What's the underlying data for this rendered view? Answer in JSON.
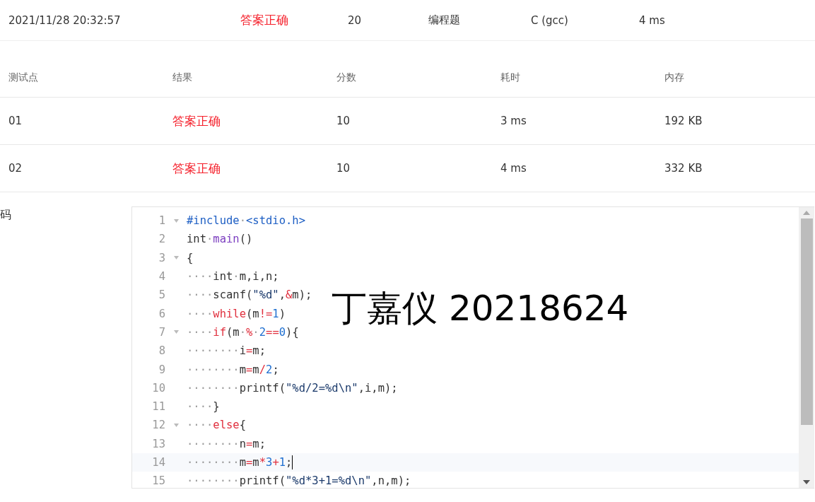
{
  "submission": {
    "time": "2021/11/28 20:32:57",
    "status": "答案正确",
    "score": "20",
    "problem_type": "编程题",
    "compiler": "C (gcc)",
    "duration": "4 ms"
  },
  "testcases": {
    "columns": [
      "测试点",
      "结果",
      "分数",
      "耗时",
      "内存"
    ],
    "rows": [
      {
        "id": "01",
        "result": "答案正确",
        "score": "10",
        "time": "3 ms",
        "memory": "192 KB"
      },
      {
        "id": "02",
        "result": "答案正确",
        "score": "10",
        "time": "4 ms",
        "memory": "332 KB"
      }
    ]
  },
  "code": {
    "label": "码",
    "overlay_text": "丁嘉仪 20218624",
    "lines": [
      {
        "number": "1",
        "foldable": true,
        "active": false,
        "tokens": [
          {
            "kind": "meta",
            "text": "#include"
          },
          {
            "kind": "ws",
            "text": "·"
          },
          {
            "kind": "meta",
            "text": "<stdio.h>"
          }
        ]
      },
      {
        "number": "2",
        "foldable": false,
        "active": false,
        "tokens": [
          {
            "kind": "plain",
            "text": "int"
          },
          {
            "kind": "ws",
            "text": "·"
          },
          {
            "kind": "def",
            "text": "main"
          },
          {
            "kind": "plain",
            "text": "()"
          }
        ]
      },
      {
        "number": "3",
        "foldable": true,
        "active": false,
        "tokens": [
          {
            "kind": "plain",
            "text": "{"
          }
        ]
      },
      {
        "number": "4",
        "foldable": false,
        "active": false,
        "tokens": [
          {
            "kind": "ws",
            "text": "····"
          },
          {
            "kind": "plain",
            "text": "int"
          },
          {
            "kind": "ws",
            "text": "·"
          },
          {
            "kind": "plain",
            "text": "m,i,n;"
          }
        ]
      },
      {
        "number": "5",
        "foldable": false,
        "active": false,
        "tokens": [
          {
            "kind": "ws",
            "text": "····"
          },
          {
            "kind": "plain",
            "text": "scanf("
          },
          {
            "kind": "str",
            "text": "\"%d\""
          },
          {
            "kind": "plain",
            "text": ","
          },
          {
            "kind": "op",
            "text": "&"
          },
          {
            "kind": "plain",
            "text": "m);"
          }
        ]
      },
      {
        "number": "6",
        "foldable": false,
        "active": false,
        "tokens": [
          {
            "kind": "ws",
            "text": "····"
          },
          {
            "kind": "ctrl",
            "text": "while"
          },
          {
            "kind": "plain",
            "text": "(m"
          },
          {
            "kind": "op",
            "text": "!="
          },
          {
            "kind": "num",
            "text": "1"
          },
          {
            "kind": "plain",
            "text": ")"
          }
        ]
      },
      {
        "number": "7",
        "foldable": true,
        "active": false,
        "tokens": [
          {
            "kind": "ws",
            "text": "····"
          },
          {
            "kind": "ctrl",
            "text": "if"
          },
          {
            "kind": "plain",
            "text": "(m"
          },
          {
            "kind": "ws",
            "text": "·"
          },
          {
            "kind": "op",
            "text": "%"
          },
          {
            "kind": "ws",
            "text": "·"
          },
          {
            "kind": "num",
            "text": "2"
          },
          {
            "kind": "op",
            "text": "=="
          },
          {
            "kind": "num",
            "text": "0"
          },
          {
            "kind": "plain",
            "text": "){"
          }
        ]
      },
      {
        "number": "8",
        "foldable": false,
        "active": false,
        "tokens": [
          {
            "kind": "ws",
            "text": "········"
          },
          {
            "kind": "plain",
            "text": "i"
          },
          {
            "kind": "op",
            "text": "="
          },
          {
            "kind": "plain",
            "text": "m;"
          }
        ]
      },
      {
        "number": "9",
        "foldable": false,
        "active": false,
        "tokens": [
          {
            "kind": "ws",
            "text": "········"
          },
          {
            "kind": "plain",
            "text": "m"
          },
          {
            "kind": "op",
            "text": "="
          },
          {
            "kind": "plain",
            "text": "m"
          },
          {
            "kind": "op",
            "text": "/"
          },
          {
            "kind": "num",
            "text": "2"
          },
          {
            "kind": "plain",
            "text": ";"
          }
        ]
      },
      {
        "number": "10",
        "foldable": false,
        "active": false,
        "tokens": [
          {
            "kind": "ws",
            "text": "········"
          },
          {
            "kind": "plain",
            "text": "printf("
          },
          {
            "kind": "str",
            "text": "\"%d/2=%d\\n\""
          },
          {
            "kind": "plain",
            "text": ",i,m);"
          }
        ]
      },
      {
        "number": "11",
        "foldable": false,
        "active": false,
        "tokens": [
          {
            "kind": "ws",
            "text": "····"
          },
          {
            "kind": "plain",
            "text": "}"
          }
        ]
      },
      {
        "number": "12",
        "foldable": true,
        "active": false,
        "tokens": [
          {
            "kind": "ws",
            "text": "····"
          },
          {
            "kind": "ctrl",
            "text": "else"
          },
          {
            "kind": "plain",
            "text": "{"
          }
        ]
      },
      {
        "number": "13",
        "foldable": false,
        "active": false,
        "tokens": [
          {
            "kind": "ws",
            "text": "········"
          },
          {
            "kind": "plain",
            "text": "n"
          },
          {
            "kind": "op",
            "text": "="
          },
          {
            "kind": "plain",
            "text": "m;"
          }
        ]
      },
      {
        "number": "14",
        "foldable": false,
        "active": true,
        "tokens": [
          {
            "kind": "ws",
            "text": "········"
          },
          {
            "kind": "plain",
            "text": "m"
          },
          {
            "kind": "op",
            "text": "="
          },
          {
            "kind": "plain",
            "text": "m"
          },
          {
            "kind": "op",
            "text": "*"
          },
          {
            "kind": "num",
            "text": "3"
          },
          {
            "kind": "op",
            "text": "+"
          },
          {
            "kind": "num",
            "text": "1"
          },
          {
            "kind": "plain",
            "text": ";"
          }
        ]
      },
      {
        "number": "15",
        "foldable": false,
        "active": false,
        "tokens": [
          {
            "kind": "ws",
            "text": "········"
          },
          {
            "kind": "plain",
            "text": "printf("
          },
          {
            "kind": "str",
            "text": "\"%d*3+1=%d\\n\""
          },
          {
            "kind": "plain",
            "text": ",n,m);"
          }
        ]
      }
    ]
  }
}
